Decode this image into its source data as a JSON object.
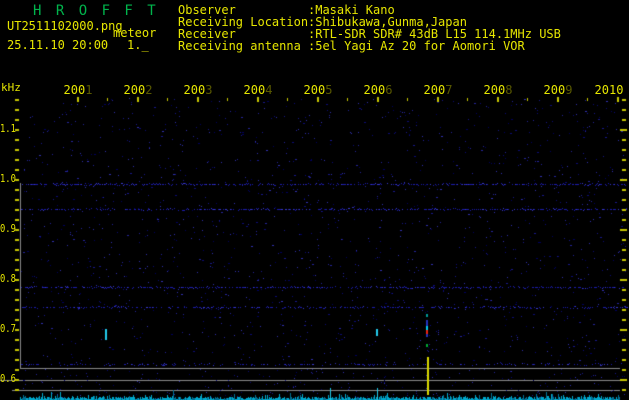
{
  "header": {
    "app_title": "H R O F F T",
    "filename": "UT2511102000.png",
    "mode_label": "meteor",
    "datetime": "25.11.10 20:00",
    "counter": "1._",
    "fields": [
      {
        "label": "Observer",
        "value": ":Masaki Kano"
      },
      {
        "label": "Receiving Location",
        "value": ":Shibukawa,Gunma,Japan"
      },
      {
        "label": "Receiver",
        "value": ":RTL-SDR SDR# 43dB L15 114.1MHz USB"
      },
      {
        "label": "Receiving antenna",
        "value": ":5el Yagi Az 20 for Aomori VOR"
      }
    ]
  },
  "chart_data": {
    "type": "heatmap",
    "title": "HROFFT 10-minute meteor radio spectrogram with noise-floor trace",
    "ylabel": "kHz",
    "y_tick_labels": [
      "1.1",
      "1.0",
      "0.9",
      "0.8",
      "0.7",
      "0.6"
    ],
    "y_range_khz": [
      0.624,
      1.164
    ],
    "x_ticks": [
      {
        "label": "2001",
        "dim_last": true
      },
      {
        "label": "2002",
        "dim_last": true
      },
      {
        "label": "2003",
        "dim_last": true
      },
      {
        "label": "2004",
        "dim_last": true
      },
      {
        "label": "2005",
        "dim_last": true
      },
      {
        "label": "2006",
        "dim_last": true
      },
      {
        "label": "2007",
        "dim_last": true
      },
      {
        "label": "2008",
        "dim_last": true
      },
      {
        "label": "2009",
        "dim_last": true
      },
      {
        "label": "2010",
        "dim_last": false
      }
    ],
    "x_range_ut": {
      "start": "20:00",
      "end": "20:10"
    },
    "carrier_bands_khz": [
      0.992,
      0.942,
      0.786,
      0.746,
      0.632
    ],
    "echoes": [
      {
        "name": "echo-1",
        "t_min": 1.45,
        "segments": [
          {
            "f1": 0.702,
            "f2": 0.68,
            "color": "#22ccee"
          }
        ]
      },
      {
        "name": "echo-2",
        "t_min": 5.97,
        "segments": [
          {
            "f1": 0.702,
            "f2": 0.688,
            "color": "#22ccee"
          }
        ]
      },
      {
        "name": "echo-3-strong",
        "t_min": 6.8,
        "segments": [
          {
            "f1": 0.732,
            "f2": 0.726,
            "color": "#009999"
          },
          {
            "f1": 0.72,
            "f2": 0.708,
            "color": "#2233bb"
          },
          {
            "f1": 0.708,
            "f2": 0.7,
            "color": "#00ccee"
          },
          {
            "f1": 0.7,
            "f2": 0.692,
            "color": "#ee2211"
          },
          {
            "f1": 0.692,
            "f2": 0.686,
            "color": "#2233bb"
          },
          {
            "f1": 0.672,
            "f2": 0.666,
            "color": "#00aa33"
          }
        ]
      }
    ],
    "long_echo_marker": {
      "t_min": 6.82,
      "color": "#d8d800"
    },
    "noise_floor_trace": {
      "color": "#00a8cc",
      "tall_spike_t_min": [
        5.2,
        5.98
      ]
    }
  },
  "colors": {
    "background": "#000000",
    "title_green": "#00b44c",
    "text_yellow": "#e6e600",
    "tick_yellow": "#c8c800",
    "axis_gray": "#8a8a8a",
    "noise_blue": "#18188c",
    "echo_cyan": "#22ccee",
    "echo_red": "#ee2211",
    "echo_green": "#00aa33",
    "trace_cyan": "#00a8cc",
    "marker_yellow": "#d8d800"
  }
}
